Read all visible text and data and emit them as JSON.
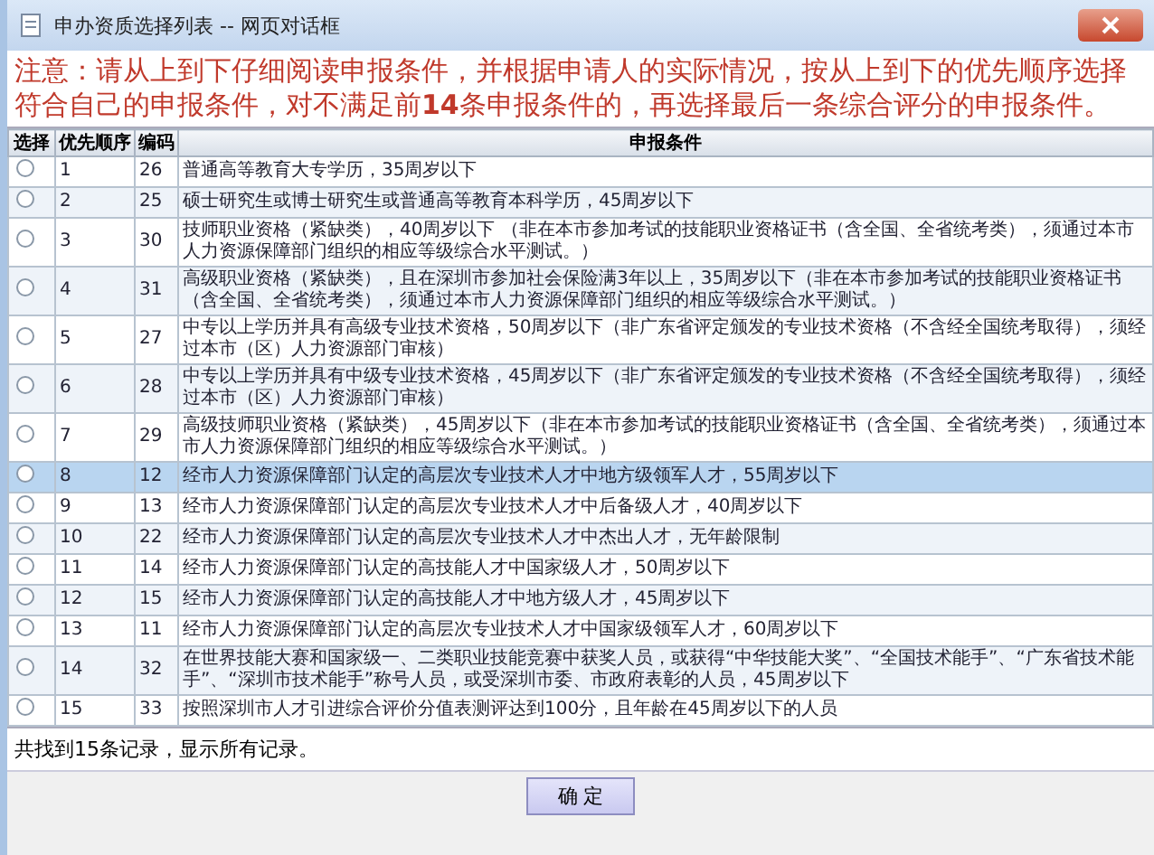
{
  "window": {
    "title": "申办资质选择列表 -- 网页对话框"
  },
  "notice": "注意：请从上到下仔细阅读申报条件，并根据申请人的实际情况，按从上到下的优先顺序选择符合自己的申报条件，对不满足前**14**条申报条件的，再选择最后一条综合评分的申报条件。",
  "table": {
    "columns": [
      "选择",
      "优先顺序",
      "编码",
      "申报条件"
    ],
    "rows": [
      {
        "priority": "1",
        "code": "26",
        "condition": "普通高等教育大专学历，35周岁以下",
        "checked": false,
        "selected": false
      },
      {
        "priority": "2",
        "code": "25",
        "condition": "硕士研究生或博士研究生或普通高等教育本科学历，45周岁以下",
        "checked": false,
        "selected": false
      },
      {
        "priority": "3",
        "code": "30",
        "condition": "技师职业资格（紧缺类），40周岁以下 （非在本市参加考试的技能职业资格证书（含全国、全省统考类），须通过本市人力资源保障部门组织的相应等级综合水平测试。）",
        "checked": false,
        "selected": false
      },
      {
        "priority": "4",
        "code": "31",
        "condition": "高级职业资格（紧缺类），且在深圳市参加社会保险满3年以上，35周岁以下（非在本市参加考试的技能职业资格证书（含全国、全省统考类），须通过本市人力资源保障部门组织的相应等级综合水平测试。）",
        "checked": false,
        "selected": false
      },
      {
        "priority": "5",
        "code": "27",
        "condition": "中专以上学历并具有高级专业技术资格，50周岁以下（非广东省评定颁发的专业技术资格（不含经全国统考取得），须经过本市（区）人力资源部门审核）",
        "checked": false,
        "selected": false
      },
      {
        "priority": "6",
        "code": "28",
        "condition": "中专以上学历并具有中级专业技术资格，45周岁以下（非广东省评定颁发的专业技术资格（不含经全国统考取得），须经过本市（区）人力资源部门审核）",
        "checked": false,
        "selected": false
      },
      {
        "priority": "7",
        "code": "29",
        "condition": "高级技师职业资格（紧缺类），45周岁以下（非在本市参加考试的技能职业资格证书（含全国、全省统考类），须通过本市人力资源保障部门组织的相应等级综合水平测试。）",
        "checked": false,
        "selected": false
      },
      {
        "priority": "8",
        "code": "12",
        "condition": "经市人力资源保障部门认定的高层次专业技术人才中地方级领军人才，55周岁以下",
        "checked": false,
        "selected": true
      },
      {
        "priority": "9",
        "code": "13",
        "condition": "经市人力资源保障部门认定的高层次专业技术人才中后备级人才，40周岁以下",
        "checked": false,
        "selected": false
      },
      {
        "priority": "10",
        "code": "22",
        "condition": "经市人力资源保障部门认定的高层次专业技术人才中杰出人才，无年龄限制",
        "checked": false,
        "selected": false
      },
      {
        "priority": "11",
        "code": "14",
        "condition": "经市人力资源保障部门认定的高技能人才中国家级人才，50周岁以下",
        "checked": false,
        "selected": false
      },
      {
        "priority": "12",
        "code": "15",
        "condition": "经市人力资源保障部门认定的高技能人才中地方级人才，45周岁以下",
        "checked": false,
        "selected": false
      },
      {
        "priority": "13",
        "code": "11",
        "condition": "经市人力资源保障部门认定的高层次专业技术人才中国家级领军人才，60周岁以下",
        "checked": false,
        "selected": false
      },
      {
        "priority": "14",
        "code": "32",
        "condition": "在世界技能大赛和国家级一、二类职业技能竞赛中获奖人员，或获得“中华技能大奖”、“全国技术能手”、“广东省技术能手”、“深圳市技术能手”称号人员，或受深圳市委、市政府表彰的人员，45周岁以下",
        "checked": false,
        "selected": false
      },
      {
        "priority": "15",
        "code": "33",
        "condition": "按照深圳市人才引进综合评价分值表测评达到100分，且年龄在45周岁以下的人员",
        "checked": false,
        "selected": false
      }
    ]
  },
  "status": "共找到15条记录，显示所有记录。",
  "buttons": [
    "确 定"
  ]
}
